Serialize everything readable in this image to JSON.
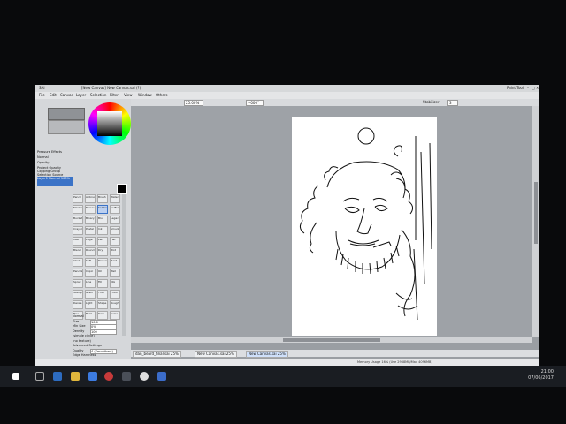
{
  "app": {
    "name": "SAI",
    "title": "[New Canvas] New Canvas.sai (?)",
    "right_text": "Paint Tool"
  },
  "menus": [
    "File",
    "Edit",
    "Canvas",
    "Layer",
    "Selection",
    "Filter",
    "View",
    "Window",
    "Others"
  ],
  "toolbar": {
    "zoom": "25.00%",
    "angle": "+000°",
    "smoothing": "Stabilizer",
    "stabilizer": "3"
  },
  "left_panel": {
    "color_wheel": "color-wheel",
    "rows": [
      "Pressure Effects",
      "Normal",
      "Opacity",
      "Protect Opacity",
      "Clipping Group",
      "Selection Source"
    ],
    "layer_name": "Layer1 Normal 100%",
    "tools": [
      "Pencil",
      "Airbrush",
      "Brush",
      "Water",
      "Marker",
      "Eraser",
      "SelPen",
      "SelErase",
      "Bucket",
      "Binary",
      "Blur",
      "Legacy",
      "Crayon",
      "Pastel",
      "Ink",
      "Smudge",
      "Mist",
      "Edge",
      "Pen",
      "Flat",
      "Blend",
      "Round",
      "Dry",
      "Blot",
      "Chalk",
      "Soft",
      "Texture",
      "Hard",
      "Pencil2",
      "Copic",
      "Oil",
      "Wet",
      "Spray",
      "Line",
      "Fill",
      "Mix",
      "Stamp",
      "Grain",
      "Thin",
      "Thick",
      "Dense",
      "Light",
      "Shape",
      "Rough",
      "Fine",
      "Bold",
      "Dark",
      "Color"
    ],
    "settings": [
      {
        "label": "Normal",
        "value": ""
      },
      {
        "label": "Size",
        "value": "10.0"
      },
      {
        "label": "Min Size",
        "value": "0%"
      },
      {
        "label": "Density",
        "value": "100"
      },
      {
        "label": "(simple circle)",
        "value": ""
      },
      {
        "label": "(no texture)",
        "value": ""
      },
      {
        "label": "Advanced Settings",
        "value": ""
      },
      {
        "label": "Quality",
        "value": "4 (Smoothest)"
      },
      {
        "label": "Edge Hardness",
        "value": ""
      }
    ]
  },
  "tabs": [
    {
      "name": "dan_beard_final.sai",
      "zoom": "25%"
    },
    {
      "name": "New Canvas.sai",
      "zoom": "25%"
    },
    {
      "name": "New Canvas.sai",
      "zoom": "25%"
    }
  ],
  "status": "Memory Usage 16% (Use 2968MB/Max 4096MB)",
  "tray": {
    "time": "21:00",
    "date": "07/06/2017"
  },
  "colors": {
    "accent": "#3b73c7",
    "canvas_bg": "#9ea2a7",
    "paper": "#ffffff"
  }
}
